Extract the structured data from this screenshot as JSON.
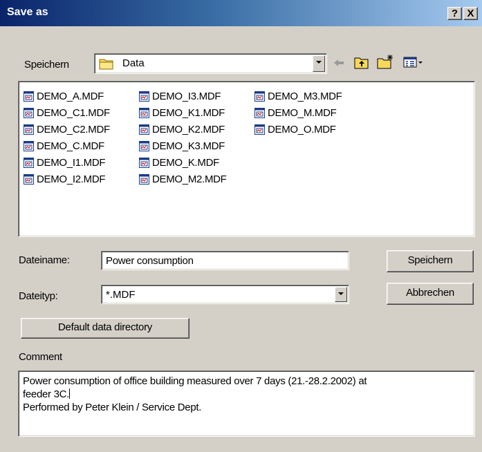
{
  "window": {
    "title": "Save as",
    "help_button": "?",
    "close_button": "X"
  },
  "toolbar": {
    "save_in_label": "Speichern",
    "location": "Data",
    "icons": [
      "back-arrow-icon",
      "up-folder-icon",
      "new-folder-icon",
      "view-menu-icon"
    ]
  },
  "files": [
    "DEMO_A.MDF",
    "DEMO_C1.MDF",
    "DEMO_C2.MDF",
    "DEMO_C.MDF",
    "DEMO_I1.MDF",
    "DEMO_I2.MDF",
    "DEMO_I3.MDF",
    "DEMO_K1.MDF",
    "DEMO_K2.MDF",
    "DEMO_K3.MDF",
    "DEMO_K.MDF",
    "DEMO_M2.MDF",
    "DEMO_M3.MDF",
    "DEMO_M.MDF",
    "DEMO_O.MDF"
  ],
  "filename": {
    "label": "Dateiname:",
    "value": "Power consumption"
  },
  "filetype": {
    "label": "Dateityp:",
    "value": "*.MDF"
  },
  "buttons": {
    "save": "Speichern",
    "cancel": "Abbrechen",
    "default_dir": "Default data directory"
  },
  "comment": {
    "label": "Comment",
    "line1": "Power consumption of office building measured over 7 days (21.-28.2.2002) at",
    "line2": "feeder 3C.",
    "line3": "Performed by Peter Klein / Service Dept."
  }
}
